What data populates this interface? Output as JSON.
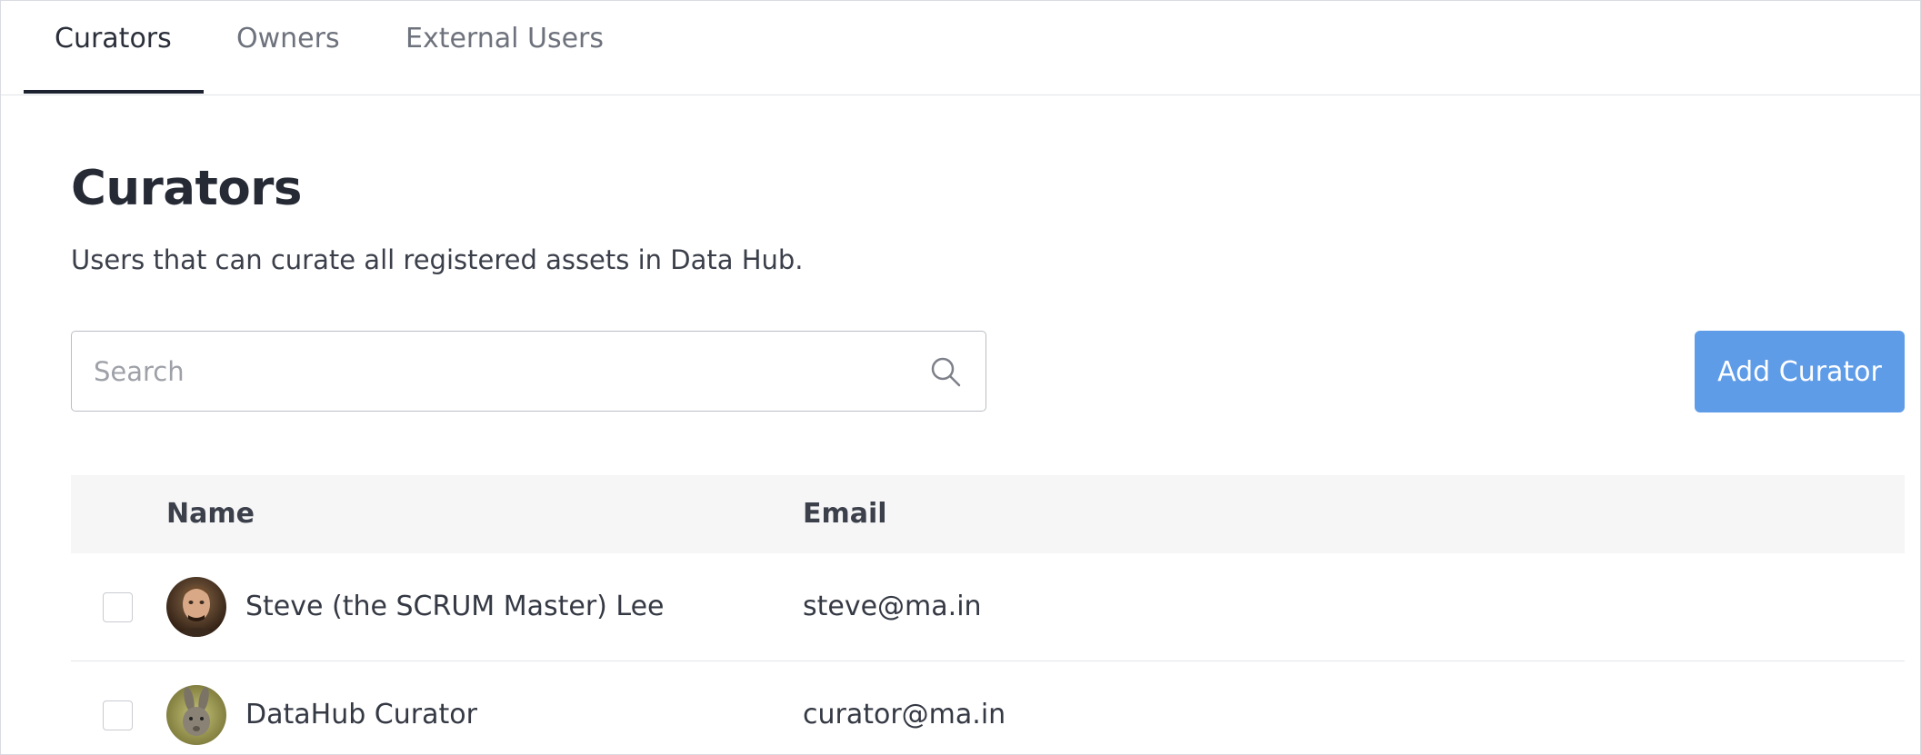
{
  "tabs": [
    {
      "label": "Curators",
      "active": true
    },
    {
      "label": "Owners",
      "active": false
    },
    {
      "label": "External Users",
      "active": false
    }
  ],
  "page": {
    "title": "Curators",
    "description": "Users that can curate all registered assets in Data Hub."
  },
  "search": {
    "placeholder": "Search",
    "value": "",
    "icon": "search-icon"
  },
  "actions": {
    "add_label": "Add Curator",
    "add_color": "#5f9ce8"
  },
  "table": {
    "headers": {
      "name": "Name",
      "email": "Email"
    },
    "rows": [
      {
        "name": "Steve (the SCRUM Master) Lee",
        "email": "steve@ma.in",
        "checked": false
      },
      {
        "name": "DataHub Curator",
        "email": "curator@ma.in",
        "checked": false
      }
    ]
  }
}
